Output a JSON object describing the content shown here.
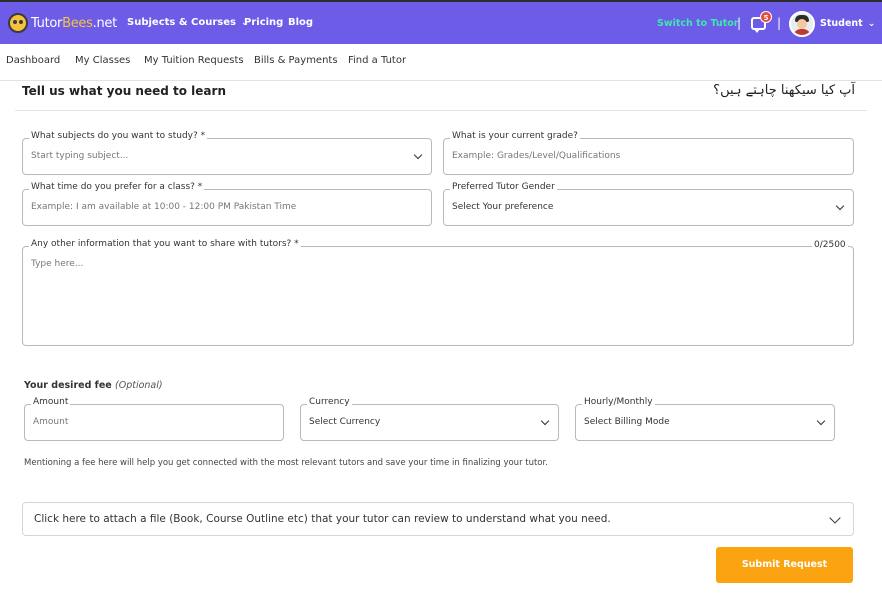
{
  "topbar": {
    "logo_prefix": "Tutor",
    "logo_brand": "Bees",
    "logo_suffix": ".net",
    "nav": {
      "subjects": "Subjects & Courses",
      "pricing": "Pricing",
      "blog": "Blog"
    },
    "switch_label": "Switch to Tutor",
    "separator": "|",
    "messages_badge": "5",
    "user_label": "Student",
    "colors": {
      "bar": "#6c5ce7",
      "switch": "#3ee8b0",
      "badge": "#e74c3c"
    },
    "icons": {
      "logo": "bee-logo-icon",
      "chevron": "chevron-down-icon",
      "messages": "chat-icon",
      "avatar": "user-avatar-icon"
    }
  },
  "subnav": {
    "items": [
      "Dashboard",
      "My Classes",
      "My Tuition Requests",
      "Bills & Payments",
      "Find a Tutor"
    ]
  },
  "form": {
    "title": "Tell us what you need to learn",
    "title_urdu": "آپ کیا سیکھنا چاہتے ہیں؟",
    "subjects": {
      "label": "What subjects do you want to study? *",
      "placeholder": "Start typing subject..."
    },
    "grade": {
      "label": "What is your current grade?",
      "placeholder": "Example: Grades/Level/Qualifications"
    },
    "time": {
      "label": "What time do you prefer for a class? *",
      "placeholder": "Example: I am available at 10:00 - 12:00 PM Pakistan Time"
    },
    "gender": {
      "label": "Preferred Tutor Gender",
      "value": "Select Your preference"
    },
    "info": {
      "label": "Any other information that you want to share with tutors? *",
      "placeholder": "Type here...",
      "counter": "0/2500"
    },
    "fee": {
      "heading": "Your desired fee",
      "optional": "(Optional)",
      "amount": {
        "label": "Amount",
        "placeholder": "Amount"
      },
      "currency": {
        "label": "Currency",
        "value": "Select Currency"
      },
      "billing": {
        "label": "Hourly/Monthly",
        "value": "Select Billing Mode"
      },
      "note": "Mentioning a fee here will help you get connected with the most relevant tutors and save your time in finalizing your tutor."
    },
    "attach_text": "Click here to attach a file (Book, Course Outline etc) that your tutor can review to understand what you need.",
    "submit_label": "Submit Request",
    "colors": {
      "submit": "#fca311"
    }
  }
}
